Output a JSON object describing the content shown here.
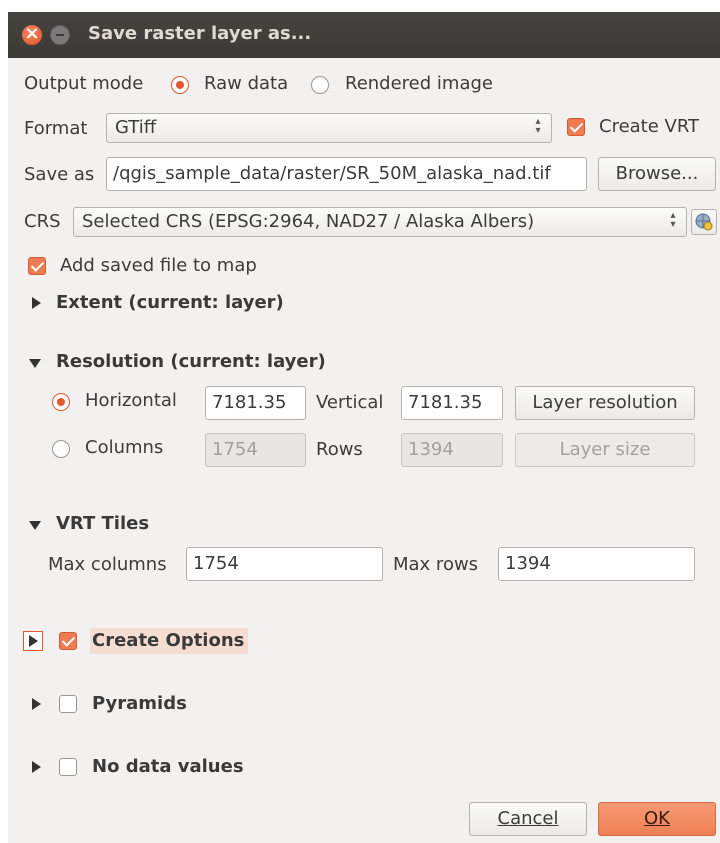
{
  "window": {
    "title": "Save raster layer as..."
  },
  "output_mode": {
    "label": "Output mode",
    "options": [
      "Raw data",
      "Rendered image"
    ],
    "selected": "Raw data"
  },
  "format": {
    "label": "Format",
    "value": "GTiff",
    "create_vrt_label": "Create VRT",
    "create_vrt_checked": true
  },
  "save_as": {
    "label": "Save as",
    "value": "/qgis_sample_data/raster/SR_50M_alaska_nad.tif",
    "browse_label": "Browse..."
  },
  "crs": {
    "label": "CRS",
    "value": "Selected CRS (EPSG:2964, NAD27 / Alaska Albers)"
  },
  "add_to_map": {
    "label": "Add saved file to map",
    "checked": true
  },
  "extent": {
    "header": "Extent (current: layer)"
  },
  "resolution": {
    "header": "Resolution (current: layer)",
    "horizontal_label": "Horizontal",
    "horizontal_value": "7181.35",
    "vertical_label": "Vertical",
    "vertical_value": "7181.35",
    "layer_resolution_label": "Layer resolution",
    "columns_label": "Columns",
    "columns_value": "1754",
    "rows_label": "Rows",
    "rows_value": "1394",
    "layer_size_label": "Layer size"
  },
  "vrt_tiles": {
    "header": "VRT Tiles",
    "max_columns_label": "Max columns",
    "max_columns_value": "1754",
    "max_rows_label": "Max rows",
    "max_rows_value": "1394"
  },
  "sections": {
    "create_options": "Create Options",
    "pyramids": "Pyramids",
    "no_data": "No data values"
  },
  "buttons": {
    "cancel": "Cancel",
    "ok": "OK"
  },
  "colors": {
    "accent": "#ee7b52",
    "titlebar": "#3e3d39",
    "dialog_bg": "#f2f1f0"
  }
}
